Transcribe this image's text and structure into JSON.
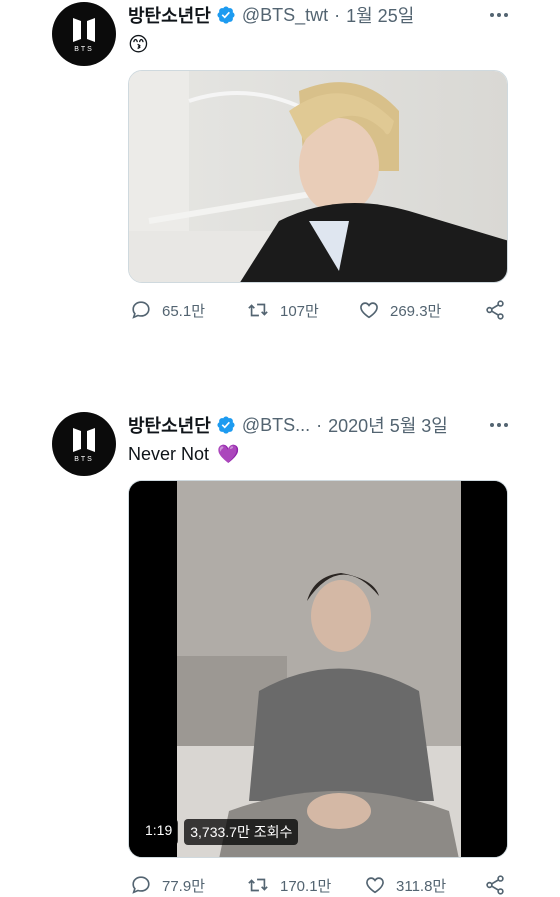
{
  "tweets": [
    {
      "name": "방탄소년단",
      "handle": "@BTS_twt",
      "separator": "·",
      "date": "1월 25일",
      "emoji": "😙",
      "text": "",
      "replies": "65.1만",
      "retweets": "107만",
      "likes": "269.3만"
    },
    {
      "name": "방탄소년단",
      "handle": "@BTS...",
      "separator": "·",
      "date": "2020년 5월 3일",
      "text": "Never Not",
      "emoji": "💜",
      "video_duration": "1:19",
      "video_views": "3,733.7만 조회수",
      "replies": "77.9만",
      "retweets": "170.1만",
      "likes": "311.8만"
    }
  ],
  "avatar_logo_text": "BTS",
  "colors": {
    "verified": "#1d9bf0",
    "secondary_text": "#536471",
    "primary_text": "#0f1419"
  }
}
